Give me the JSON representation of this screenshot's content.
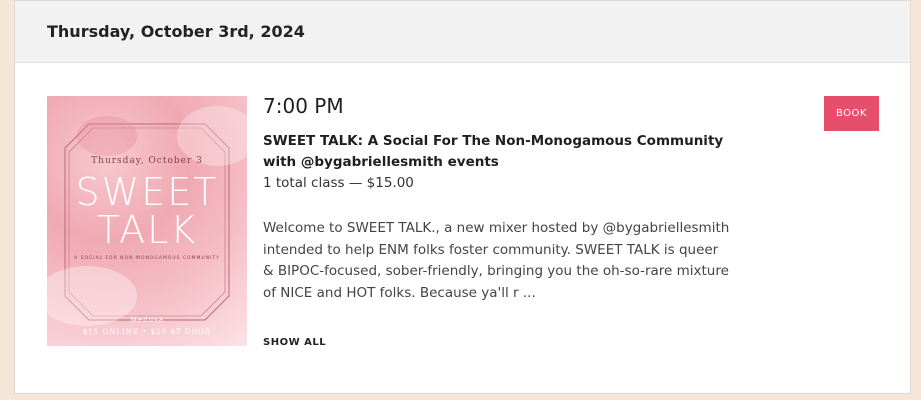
{
  "date_header": "Thursday, October 3rd, 2024",
  "event": {
    "time": "7:00 PM",
    "title": "SWEET TALK: A Social For The Non-Monogamous Community with @bygabriellesmith events",
    "class_info": "1 total class — $15.00",
    "description": "Welcome to SWEET TALK., a new mixer hosted by @bygabriellesmith intended to help ENM folks foster community. SWEET TALK is queer & BIPOC-focused, sober-friendly, bringing you the oh-so-rare mixture of NICE and HOT folks. Because ya'll r ...",
    "show_all_label": "SHOW ALL",
    "book_label": "BOOK"
  },
  "poster": {
    "date": "Thursday, October 3",
    "title_line1": "SWEET",
    "title_line2": "TALK",
    "subtitle": "A SOCIAL FOR NON-MONOGAMOUS COMMUNITY",
    "venue": "Medusa",
    "price": "$15 ONLINE • $20 AT DOOR"
  },
  "colors": {
    "accent": "#e64f6b",
    "page_background": "#f5e6da",
    "header_background": "#f2f2f2"
  }
}
